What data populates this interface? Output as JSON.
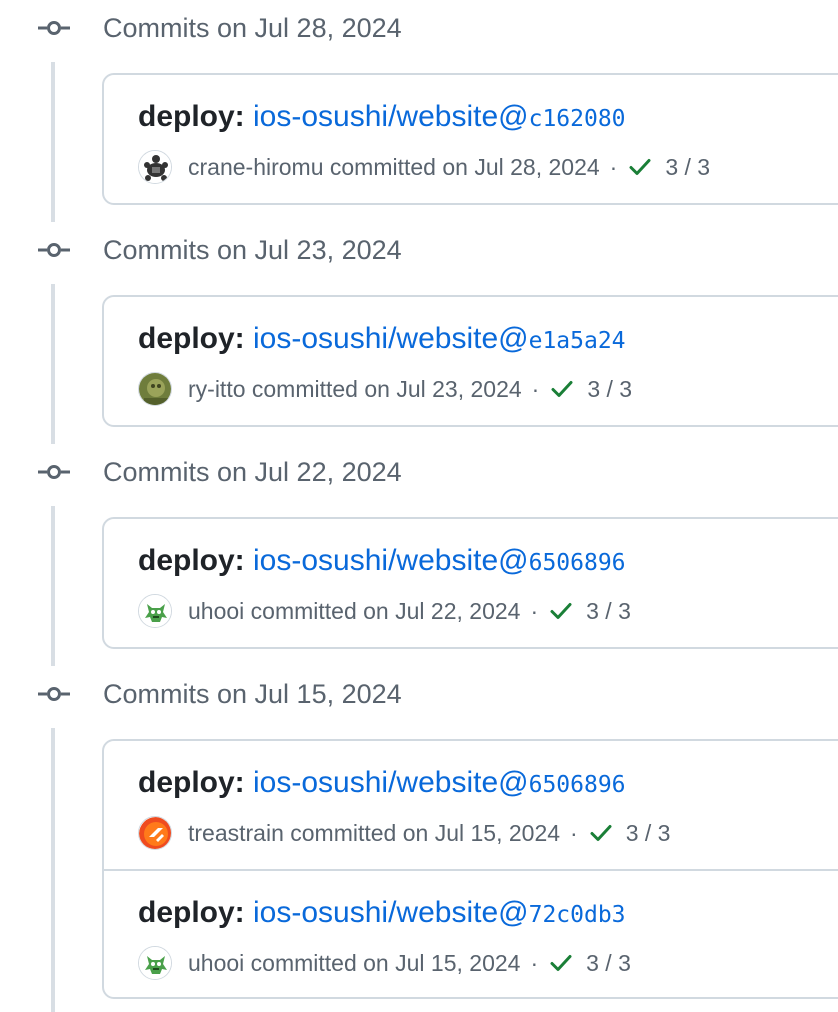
{
  "groups": [
    {
      "date": "Commits on Jul 28, 2024",
      "commits": [
        {
          "prefix": "deploy:",
          "repo": "ios-osushi/website@",
          "sha": "c162080",
          "author": "crane-hiromu",
          "action": "committed on Jul 28, 2024",
          "separator": "·",
          "checks": "3 / 3",
          "avatar_icon": "turtle-avatar",
          "avatar_color": "#ffffff"
        }
      ]
    },
    {
      "date": "Commits on Jul 23, 2024",
      "commits": [
        {
          "prefix": "deploy:",
          "repo": "ios-osushi/website@",
          "sha": "e1a5a24",
          "author": "ry-itto",
          "action": "committed on Jul 23, 2024",
          "separator": "·",
          "checks": "3 / 3",
          "avatar_icon": "photo-avatar",
          "avatar_color": "#6f7d3c"
        }
      ]
    },
    {
      "date": "Commits on Jul 22, 2024",
      "commits": [
        {
          "prefix": "deploy:",
          "repo": "ios-osushi/website@",
          "sha": "6506896",
          "author": "uhooi",
          "action": "committed on Jul 22, 2024",
          "separator": "·",
          "checks": "3 / 3",
          "avatar_icon": "monster-avatar",
          "avatar_color": "#4aa04a"
        }
      ]
    },
    {
      "date": "Commits on Jul 15, 2024",
      "commits": [
        {
          "prefix": "deploy:",
          "repo": "ios-osushi/website@",
          "sha": "6506896",
          "author": "treastrain",
          "action": "committed on Jul 15, 2024",
          "separator": "·",
          "checks": "3 / 3",
          "avatar_icon": "logo-avatar",
          "avatar_color": "#ef4b1f"
        },
        {
          "prefix": "deploy:",
          "repo": "ios-osushi/website@",
          "sha": "72c0db3",
          "author": "uhooi",
          "action": "committed on Jul 15, 2024",
          "separator": "·",
          "checks": "3 / 3",
          "avatar_icon": "monster-avatar",
          "avatar_color": "#4aa04a"
        }
      ]
    }
  ],
  "colors": {
    "link": "#0969da",
    "muted": "#59636e",
    "success": "#1a7f37",
    "border": "#d1d9e0"
  }
}
